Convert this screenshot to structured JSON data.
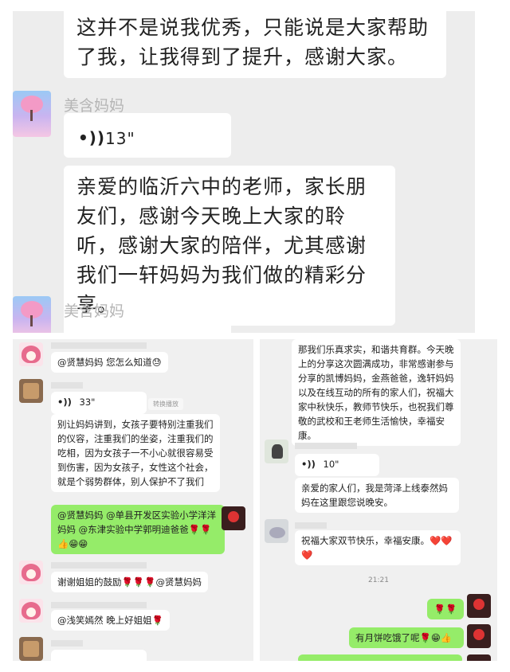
{
  "top": {
    "msg1": "这并不是说我优秀，只能说是大家帮助了我，让我得到了提升，感谢大家。",
    "sender": "美含妈妈",
    "voice_icon": "•))",
    "voice_duration": "13\"",
    "msg2": "亲爱的临沂六中的老师，家长朋友们，感谢今天晚上大家的聆听，感谢大家的陪伴，尤其感谢我们一轩妈妈为我们做的精彩分享。",
    "sender2": "美含妈妈"
  },
  "left": {
    "msg1": "@贤慧妈妈 您怎么知道😓",
    "voice_duration": "33\"",
    "voice_tag": "转换播放",
    "msg2": "别让妈妈讲到，女孩子要特别注重我们的仪容，注重我们的坐姿，注重我们的吃相，因为女孩子一不小心就很容易受到伤害，因为女孩子，女性这个社会，就是个弱势群体，别人保护不了我们",
    "msg3": "@贤慧妈妈 @单县开发区实验小学洋洋妈妈 @东津实验中学郭明迪爸爸🌹🌹👍😁😁",
    "msg4": "谢谢姐姐的鼓励🌹🌹🌹@贤慧妈妈",
    "msg5": "@浅笑嫣然 晚上好姐姐🌹"
  },
  "right": {
    "msg1": "那我们乐真求实，和谐共育群。今天晚上的分享这次圆满成功，非常感谢参与分享的凯博妈妈，金燕爸爸，逸轩妈妈以及在线互动的所有的家人们，祝福大家中秋快乐，教师节快乐，也祝我们尊敬的武校和王老师生活愉快，幸福安康。",
    "voice_duration": "10\"",
    "msg2": "亲爱的家人们，我是菏泽上线泰然妈妈在这里跟您说晚安。",
    "msg3": "祝福大家双节快乐，幸福安康。❤️❤️❤️",
    "time": "21:21",
    "msg4": "🌹🌹",
    "msg5": "有月饼吃饿了呢🌹😁👍"
  },
  "colors": {
    "green_bubble": "#95ec69",
    "panel_bg": "#ededed",
    "name_gray": "#b5b5b5"
  }
}
